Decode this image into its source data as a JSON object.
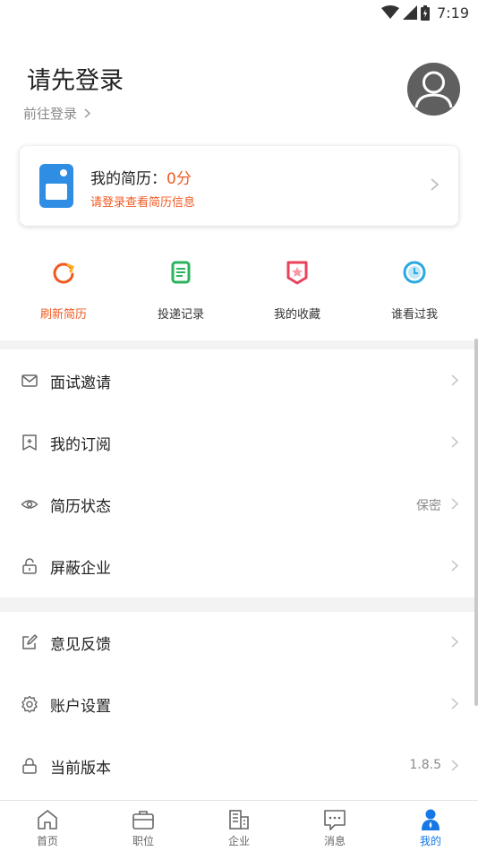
{
  "status_bar": {
    "time": "7:19"
  },
  "header": {
    "title": "请先登录",
    "login_link": "前往登录"
  },
  "resume_card": {
    "title": "我的简历：",
    "score": "0分",
    "hint": "请登录查看简历信息"
  },
  "quick_actions": [
    {
      "label": "刷新简历",
      "icon": "refresh-icon",
      "color": "#f05a22"
    },
    {
      "label": "投递记录",
      "icon": "document-icon",
      "color": "#2bb35c"
    },
    {
      "label": "我的收藏",
      "icon": "favorite-icon",
      "color": "#e8435a"
    },
    {
      "label": "谁看过我",
      "icon": "clock-icon",
      "color": "#2aa8e0"
    }
  ],
  "menu": [
    {
      "label": "面试邀请",
      "icon": "mail-icon",
      "value": ""
    },
    {
      "label": "我的订阅",
      "icon": "subscribe-icon",
      "value": ""
    },
    {
      "label": "简历状态",
      "icon": "eye-icon",
      "value": "保密"
    },
    {
      "label": "屏蔽企业",
      "icon": "unlock-icon",
      "value": ""
    },
    {
      "label": "意见反馈",
      "icon": "edit-icon",
      "value": ""
    },
    {
      "label": "账户设置",
      "icon": "gear-icon",
      "value": ""
    },
    {
      "label": "当前版本",
      "icon": "lock-icon",
      "value": "1.8.5"
    }
  ],
  "bottom_nav": [
    {
      "label": "首页",
      "icon": "home-icon",
      "active": false
    },
    {
      "label": "职位",
      "icon": "briefcase-icon",
      "active": false
    },
    {
      "label": "企业",
      "icon": "building-icon",
      "active": false
    },
    {
      "label": "消息",
      "icon": "message-icon",
      "active": false
    },
    {
      "label": "我的",
      "icon": "person-icon",
      "active": true
    }
  ],
  "colors": {
    "accent": "#f05a22",
    "nav_active": "#1677e6",
    "resume_icon": "#2f8de4"
  }
}
